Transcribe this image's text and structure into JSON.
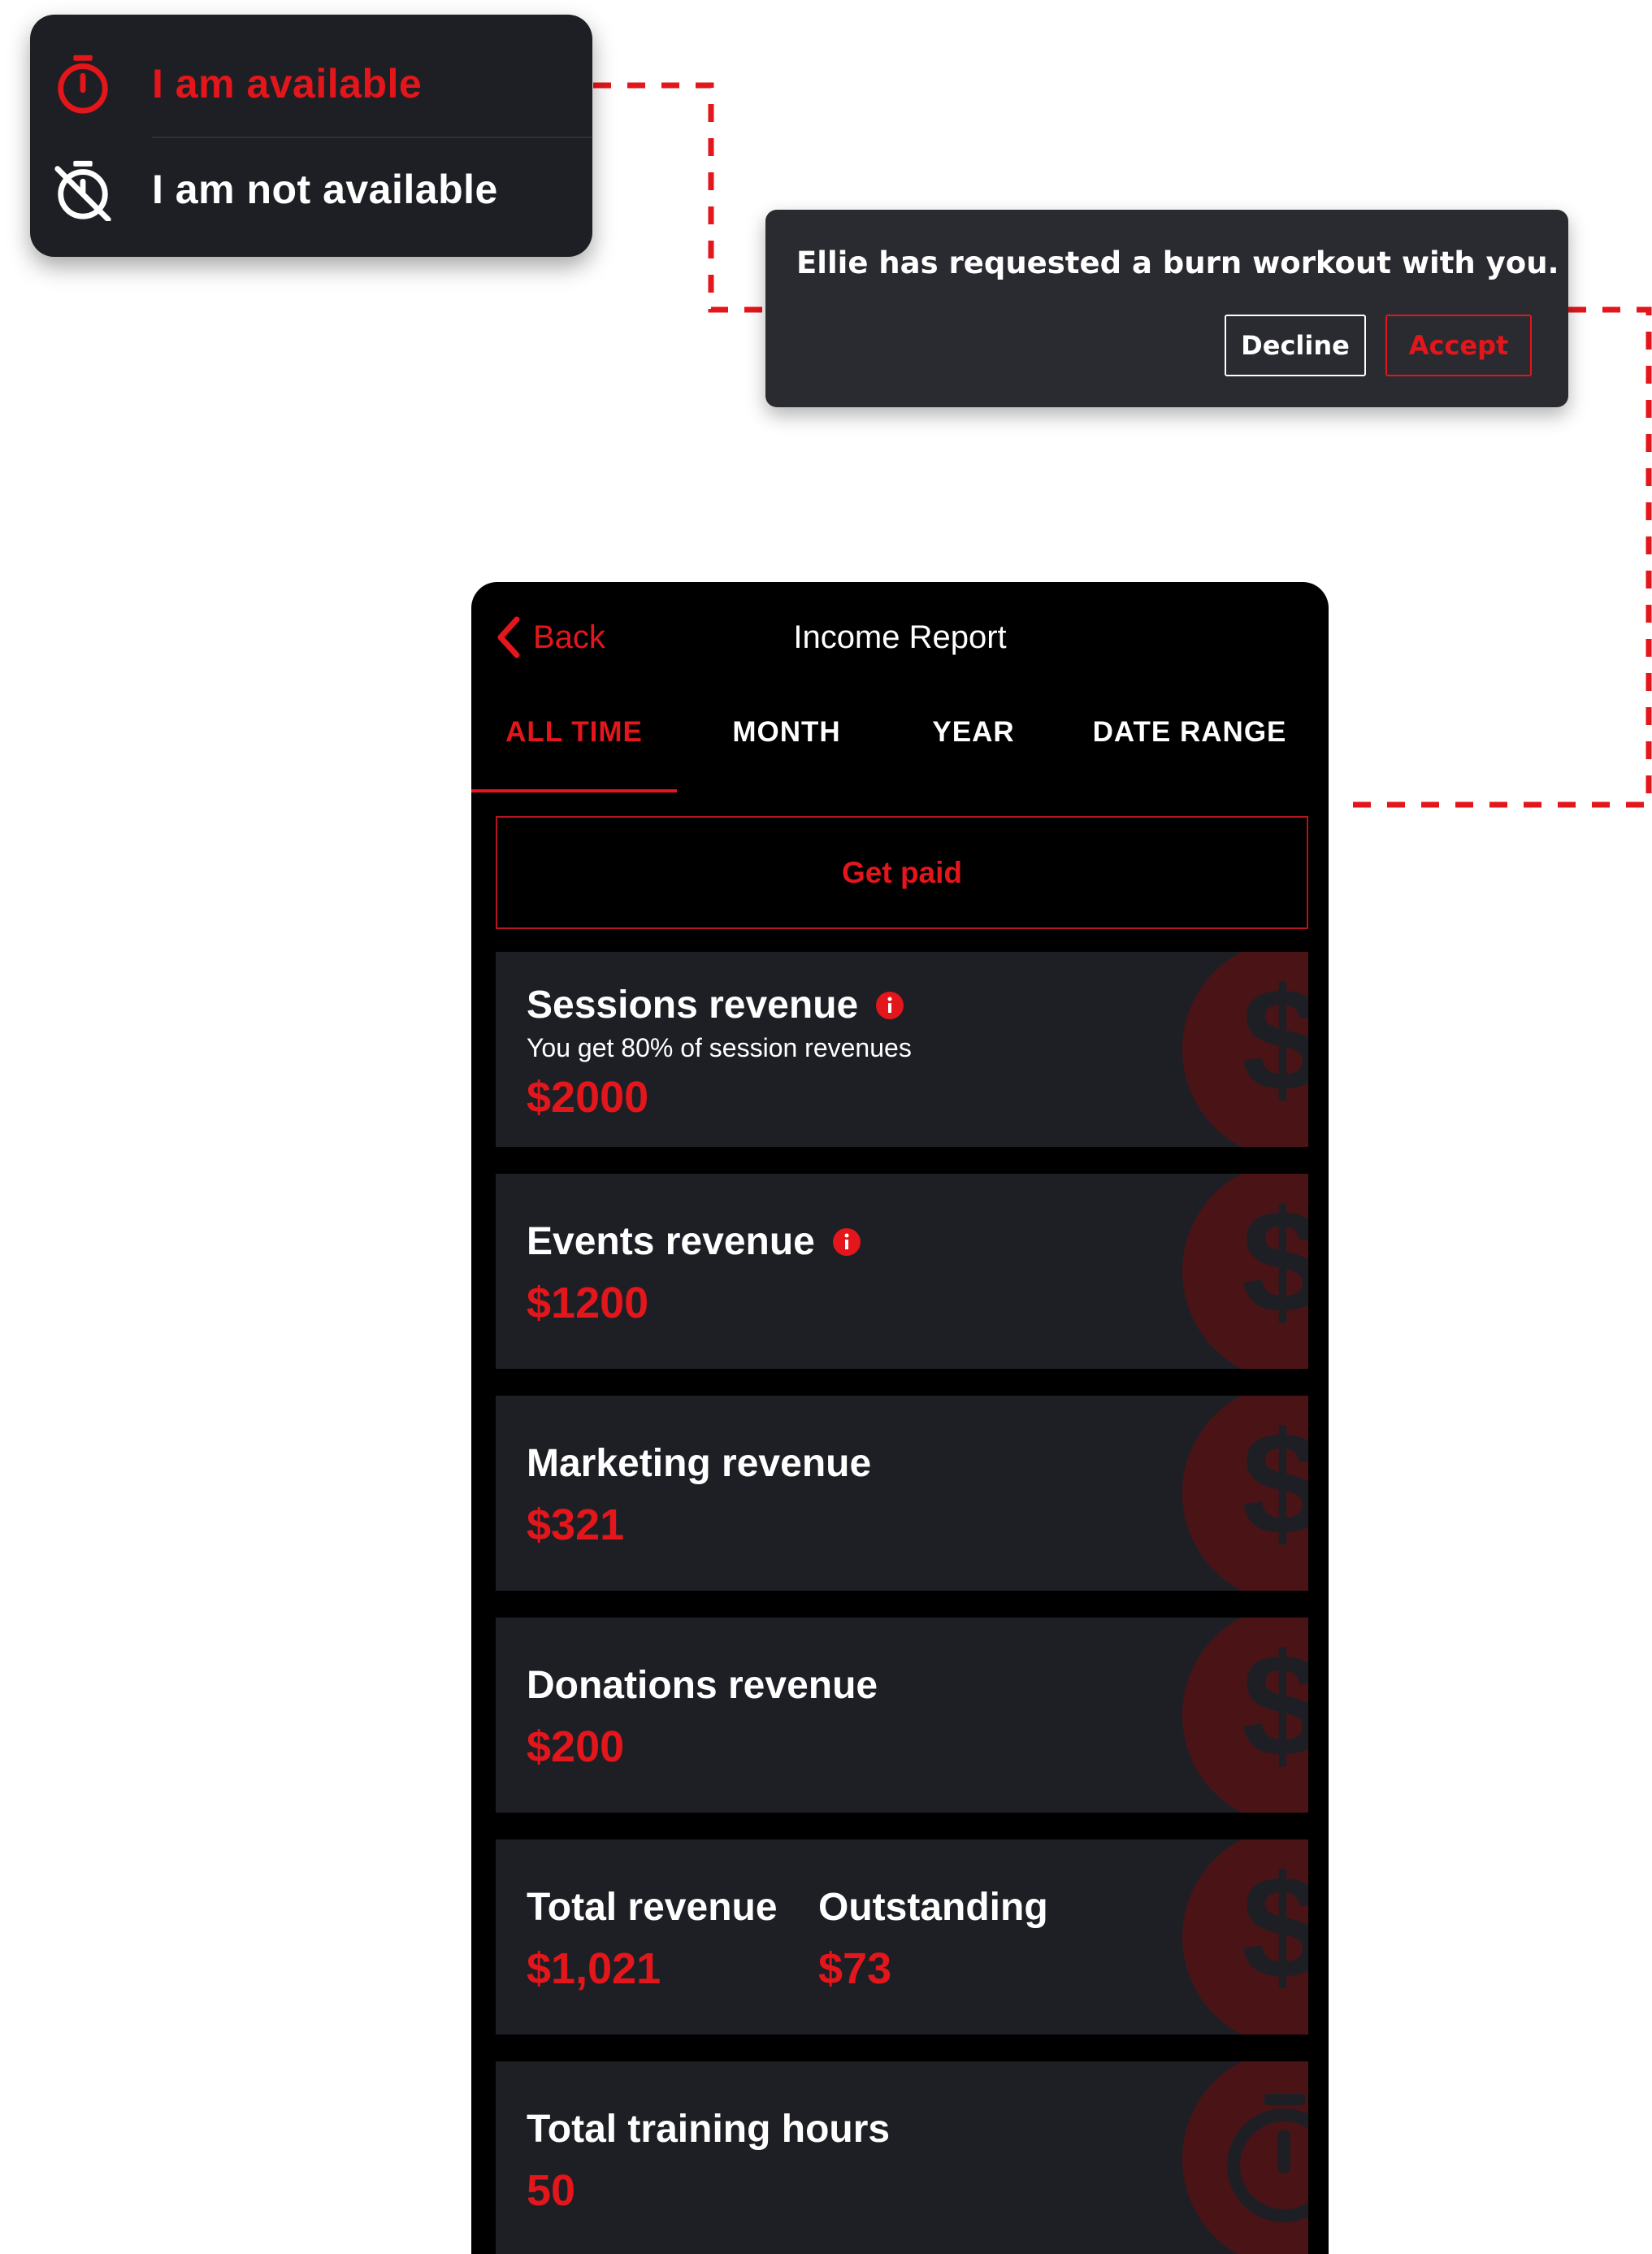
{
  "availability_menu": {
    "available_label": "I am available",
    "not_available_label": "I am not available"
  },
  "notification": {
    "message": "Ellie has requested a burn workout with you.",
    "decline_label": "Decline",
    "accept_label": "Accept"
  },
  "income_report": {
    "back_label": "Back",
    "title": "Income Report",
    "tabs": [
      {
        "label": "ALL TIME",
        "active": true
      },
      {
        "label": "MONTH",
        "active": false
      },
      {
        "label": "YEAR",
        "active": false
      },
      {
        "label": "DATE RANGE",
        "active": false
      }
    ],
    "get_paid_label": "Get paid",
    "cards": {
      "sessions": {
        "title": "Sessions revenue",
        "subtitle": "You get 80% of session revenues",
        "value": "$2000",
        "info_icon": "info-icon",
        "bg_icon": "dollar-icon"
      },
      "events": {
        "title": "Events revenue",
        "value": "$1200",
        "info_icon": "info-icon",
        "bg_icon": "dollar-icon"
      },
      "marketing": {
        "title": "Marketing revenue",
        "value": "$321",
        "bg_icon": "dollar-icon"
      },
      "donations": {
        "title": "Donations revenue",
        "value": "$200",
        "bg_icon": "dollar-icon"
      },
      "totals": {
        "total_title": "Total revenue",
        "total_value": "$1,021",
        "outstanding_title": "Outstanding",
        "outstanding_value": "$73",
        "bg_icon": "dollar-icon"
      },
      "training": {
        "title": "Total training hours",
        "value": "50",
        "bg_icon": "stopwatch-icon"
      }
    }
  },
  "colors": {
    "accent": "#e3161b",
    "card_background": "#1e1f25",
    "screen_background": "#000000",
    "popover_background": "#1e1f25",
    "notification_background": "#2a2b31"
  }
}
